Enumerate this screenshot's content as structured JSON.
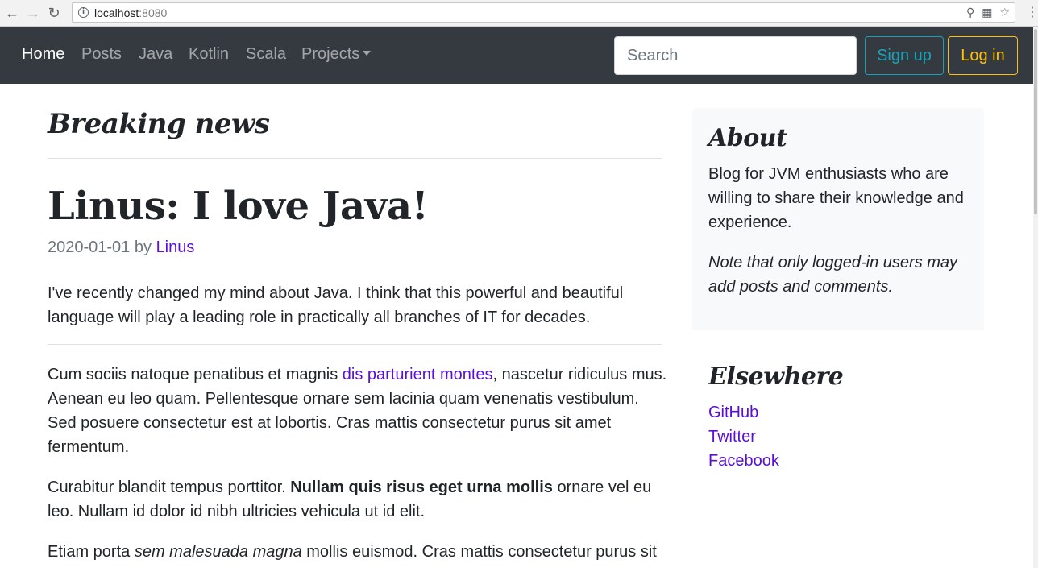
{
  "browser": {
    "url_host": "localhost",
    "url_port": ":8080",
    "back_icon": "arrow-left-icon",
    "forward_icon": "arrow-right-icon",
    "reload_icon": "reload-icon"
  },
  "navbar": {
    "links": [
      "Home",
      "Posts",
      "Java",
      "Kotlin",
      "Scala",
      "Projects"
    ],
    "search_placeholder": "Search",
    "signup_label": "Sign up",
    "login_label": "Log in"
  },
  "main": {
    "section_heading": "Breaking news",
    "post": {
      "title": "Linus: I love Java!",
      "date": "2020-01-01",
      "by": "by",
      "author": "Linus",
      "lead": "I've recently changed my mind about Java. I think that this powerful and beautiful language will play a leading role in practically all branches of IT for decades.",
      "p1_before": "Cum sociis natoque penatibus et magnis ",
      "p1_link": "dis parturient montes",
      "p1_after": ", nascetur ridiculus mus. Aenean eu leo quam. Pellentesque ornare sem lacinia quam venenatis vestibulum. Sed posuere consectetur est at lobortis. Cras mattis consectetur purus sit amet fermentum.",
      "p2_before": "Curabitur blandit tempus porttitor. ",
      "p2_bold": "Nullam quis risus eget urna mollis",
      "p2_after": " ornare vel eu leo. Nullam id dolor id nibh ultricies vehicula ut id elit.",
      "p3_before": "Etiam porta ",
      "p3_italic": "sem malesuada magna",
      "p3_after": " mollis euismod. Cras mattis consectetur purus sit"
    }
  },
  "sidebar": {
    "about_heading": "About",
    "about_text": "Blog for JVM enthusiasts who are willing to share their knowledge and experience.",
    "about_note": "Note that only logged-in users may add posts and comments.",
    "elsewhere_heading": "Elsewhere",
    "elsewhere_links": [
      "GitHub",
      "Twitter",
      "Facebook"
    ]
  },
  "colors": {
    "navbar_bg": "#343a40",
    "link": "#5a0fd6",
    "signup": "#17a2b8",
    "login": "#ffc107"
  }
}
